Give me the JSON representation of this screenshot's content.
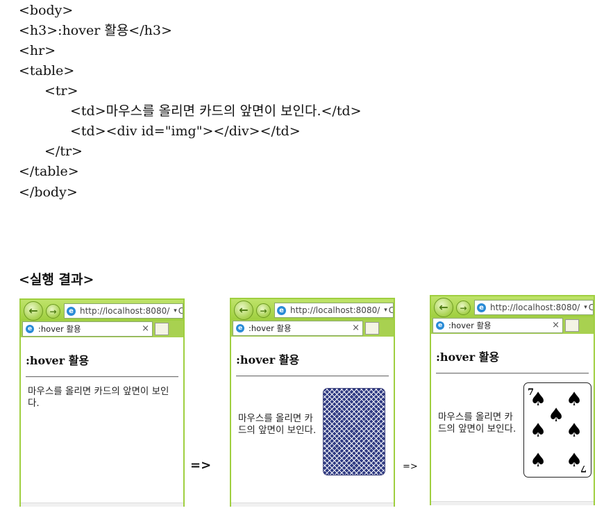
{
  "code_lines": [
    "<body>",
    "<h3>:hover 활용</h3>",
    "<hr>",
    "<table>",
    "<tr>",
    "<td>마우스를 올리면 카드의 앞면이 보인다.</td>",
    "<td><div id=\"img\"></div></td>",
    "</tr>",
    "</table>",
    "</body>"
  ],
  "result_heading": "<실행 결과>",
  "browser": {
    "url": "http://localhost:8080/",
    "tab_title": ":hover 활용",
    "tab_close": "×",
    "page_h3": ":hover 활용",
    "page_td_text": "마우스를 올리면 카드의 앞면이 보인다.",
    "ie_icon_glyph": "e",
    "back_glyph": "←",
    "forward_glyph": "→",
    "dropdown_glyph": "▾",
    "refresh_glyph": "C"
  },
  "screenshots": [
    {
      "label": "before-loaded",
      "card_state": "none"
    },
    {
      "label": "card-back-shown",
      "card_state": "back"
    },
    {
      "label": "card-front-shown-on-hover",
      "card_state": "front"
    }
  ],
  "arrows": [
    "=>",
    "=>"
  ],
  "card_front": {
    "rank": "7",
    "suit": "♠",
    "suit_color": "#000000"
  },
  "card_back": {
    "color": "#2f3a82"
  },
  "colors": {
    "browser_accent": "#9fcf3f",
    "text": "#111111"
  }
}
